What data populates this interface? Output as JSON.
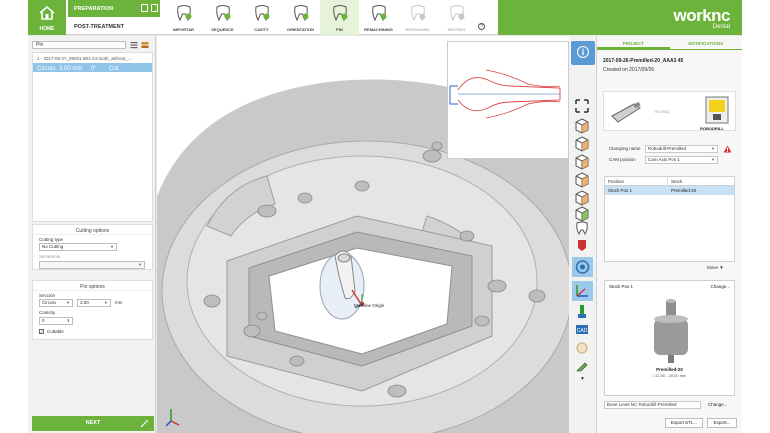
{
  "header": {
    "home_label": "HOME",
    "stage_preparation": "PREPARATION",
    "stage_post": "POST-TREATMENT",
    "steps": [
      {
        "label": "IMPORTAR",
        "state": "done"
      },
      {
        "label": "SEQUENCE",
        "state": "done"
      },
      {
        "label": "CAVITY",
        "state": "done"
      },
      {
        "label": "ORIENTATION",
        "state": "done"
      },
      {
        "label": "PIN",
        "state": "active"
      },
      {
        "label": "REMACHINING",
        "state": "done"
      },
      {
        "label": "ENGRAVING",
        "state": "disabled"
      },
      {
        "label": "NESTING",
        "state": "disabled"
      }
    ],
    "help": "?",
    "brand": "worknc",
    "brand_sub": "Dental",
    "accent": "#6bb33a"
  },
  "left": {
    "search_value": "Pin",
    "tree_title": "1 - 2017-05-27_09001-881-24-tooth_without_...",
    "tree_row": {
      "shape": "Circulo",
      "size": "3.00 mm",
      "angle": "0°",
      "cut": "Cut"
    },
    "cutting": {
      "title": "Cutting options",
      "type_label": "Cutting type",
      "type_value": "No Cutting",
      "sequence_label": "Secuencia",
      "sequence_value": ""
    },
    "pin": {
      "title": "Pin options",
      "section_label": "Sección",
      "section_value": "Circulo",
      "size_value": "3.00",
      "size_unit": "mm",
      "conicity_label": "Conicity",
      "conicity_value": "0",
      "cuttable_label": "Cuttable",
      "cuttable_checked": true
    },
    "next_label": "NEXT"
  },
  "viewport": {
    "origin_label": "Machine Origin"
  },
  "right": {
    "tab_project": "PROJECT",
    "tab_notifications": "NOTIFICATIONS",
    "project_name": "2017-09-26-Premilled-20_AAA3 45",
    "created": "Created on 2017/09/26",
    "machine_name": "ROBODRILL",
    "machine_mid": "TECHNIQ",
    "clamping_label": "Clamping name",
    "clamping_value": "Robodrill-Premilled",
    "cam_label": "CAM position",
    "cam_value": "Cam Axis Pos 1",
    "table_headers": [
      "Position",
      "Stock"
    ],
    "table_rows": [
      [
        "Stock Pos 1",
        "Premilled-20"
      ]
    ],
    "move_label": "Move",
    "stock_title": "Stock Pos 1",
    "stock_change": "Change...",
    "stock_name": "Premilled-20",
    "stock_dims": "□12.00 - 20.00 mm",
    "implant_value": "Bone Level NC Robodrill-Premilled",
    "implant_change": "Change...",
    "export_stl": "Export STL...",
    "export": "Export..."
  }
}
